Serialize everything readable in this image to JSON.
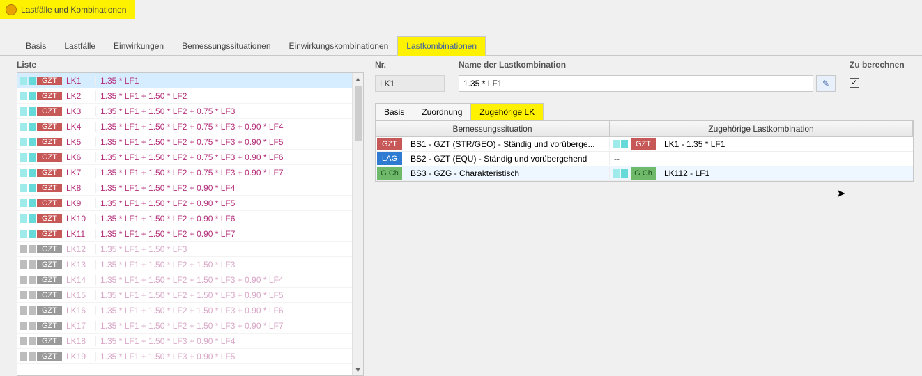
{
  "window": {
    "title": "Lastfälle und Kombinationen"
  },
  "tabs": [
    "Basis",
    "Lastfälle",
    "Einwirkungen",
    "Bemessungssituationen",
    "Einwirkungskombinationen",
    "Lastkombinationen"
  ],
  "active_tab": "Lastkombinationen",
  "list_label": "Liste",
  "rows": [
    {
      "sw": "cyan",
      "badge": "GZT",
      "bclass": "red",
      "lk": "LK1",
      "f": "1.35 * LF1",
      "sel": true,
      "dim": false
    },
    {
      "sw": "cyan",
      "badge": "GZT",
      "bclass": "red",
      "lk": "LK2",
      "f": "1.35 * LF1 + 1.50 * LF2",
      "dim": false
    },
    {
      "sw": "cyan",
      "badge": "GZT",
      "bclass": "red",
      "lk": "LK3",
      "f": "1.35 * LF1 + 1.50 * LF2 + 0.75 * LF3",
      "dim": false
    },
    {
      "sw": "cyan",
      "badge": "GZT",
      "bclass": "red",
      "lk": "LK4",
      "f": "1.35 * LF1 + 1.50 * LF2 + 0.75 * LF3 + 0.90 * LF4",
      "dim": false
    },
    {
      "sw": "cyan",
      "badge": "GZT",
      "bclass": "red",
      "lk": "LK5",
      "f": "1.35 * LF1 + 1.50 * LF2 + 0.75 * LF3 + 0.90 * LF5",
      "dim": false
    },
    {
      "sw": "cyan",
      "badge": "GZT",
      "bclass": "red",
      "lk": "LK6",
      "f": "1.35 * LF1 + 1.50 * LF2 + 0.75 * LF3 + 0.90 * LF6",
      "dim": false
    },
    {
      "sw": "cyan",
      "badge": "GZT",
      "bclass": "red",
      "lk": "LK7",
      "f": "1.35 * LF1 + 1.50 * LF2 + 0.75 * LF3 + 0.90 * LF7",
      "dim": false
    },
    {
      "sw": "cyan",
      "badge": "GZT",
      "bclass": "red",
      "lk": "LK8",
      "f": "1.35 * LF1 + 1.50 * LF2 + 0.90 * LF4",
      "dim": false
    },
    {
      "sw": "cyan",
      "badge": "GZT",
      "bclass": "red",
      "lk": "LK9",
      "f": "1.35 * LF1 + 1.50 * LF2 + 0.90 * LF5",
      "dim": false
    },
    {
      "sw": "cyan",
      "badge": "GZT",
      "bclass": "red",
      "lk": "LK10",
      "f": "1.35 * LF1 + 1.50 * LF2 + 0.90 * LF6",
      "dim": false
    },
    {
      "sw": "cyan",
      "badge": "GZT",
      "bclass": "red",
      "lk": "LK11",
      "f": "1.35 * LF1 + 1.50 * LF2 + 0.90 * LF7",
      "dim": false
    },
    {
      "sw": "gray",
      "badge": "GZT",
      "bclass": "gray",
      "lk": "LK12",
      "f": "1.35 * LF1 + 1.50 * LF3",
      "dim": true
    },
    {
      "sw": "gray",
      "badge": "GZT",
      "bclass": "gray",
      "lk": "LK13",
      "f": "1.35 * LF1 + 1.50 * LF2 + 1.50 * LF3",
      "dim": true
    },
    {
      "sw": "gray",
      "badge": "GZT",
      "bclass": "gray",
      "lk": "LK14",
      "f": "1.35 * LF1 + 1.50 * LF2 + 1.50 * LF3 + 0.90 * LF4",
      "dim": true
    },
    {
      "sw": "gray",
      "badge": "GZT",
      "bclass": "gray",
      "lk": "LK15",
      "f": "1.35 * LF1 + 1.50 * LF2 + 1.50 * LF3 + 0.90 * LF5",
      "dim": true
    },
    {
      "sw": "gray",
      "badge": "GZT",
      "bclass": "gray",
      "lk": "LK16",
      "f": "1.35 * LF1 + 1.50 * LF2 + 1.50 * LF3 + 0.90 * LF6",
      "dim": true
    },
    {
      "sw": "gray",
      "badge": "GZT",
      "bclass": "gray",
      "lk": "LK17",
      "f": "1.35 * LF1 + 1.50 * LF2 + 1.50 * LF3 + 0.90 * LF7",
      "dim": true
    },
    {
      "sw": "gray",
      "badge": "GZT",
      "bclass": "gray",
      "lk": "LK18",
      "f": "1.35 * LF1 + 1.50 * LF3 + 0.90 * LF4",
      "dim": true
    },
    {
      "sw": "gray",
      "badge": "GZT",
      "bclass": "gray",
      "lk": "LK19",
      "f": "1.35 * LF1 + 1.50 * LF3 + 0.90 * LF5",
      "dim": true
    }
  ],
  "fields": {
    "nr_label": "Nr.",
    "nr_value": "LK1",
    "name_label": "Name der Lastkombination",
    "name_value": "1.35 * LF1",
    "chk_label": "Zu berechnen",
    "chk_checked": "✓"
  },
  "subtabs": [
    "Basis",
    "Zuordnung",
    "Zugehörige LK"
  ],
  "active_subtab": "Zugehörige LK",
  "grid": {
    "h1": "Bemessungssituation",
    "h2": "Zugehörige Lastkombination",
    "rows": [
      {
        "b": "GZT",
        "bc": "red",
        "t1": "BS1 - GZT (STR/GEO) - Ständig und vorüberge...",
        "sw": "cyan",
        "b2": "GZT",
        "bc2": "red",
        "t2": "LK1 - 1.35 * LF1"
      },
      {
        "b": "LAG",
        "bc": "blue",
        "t1": "BS2 - GZT (EQU) - Ständig und vorübergehend",
        "t2": "--"
      },
      {
        "b": "G Ch",
        "bc": "green",
        "t1": "BS3 - GZG - Charakteristisch",
        "sw": "cyan",
        "b2": "G Ch",
        "bc2": "green",
        "t2": "LK112 - LF1",
        "sel": true
      }
    ]
  }
}
